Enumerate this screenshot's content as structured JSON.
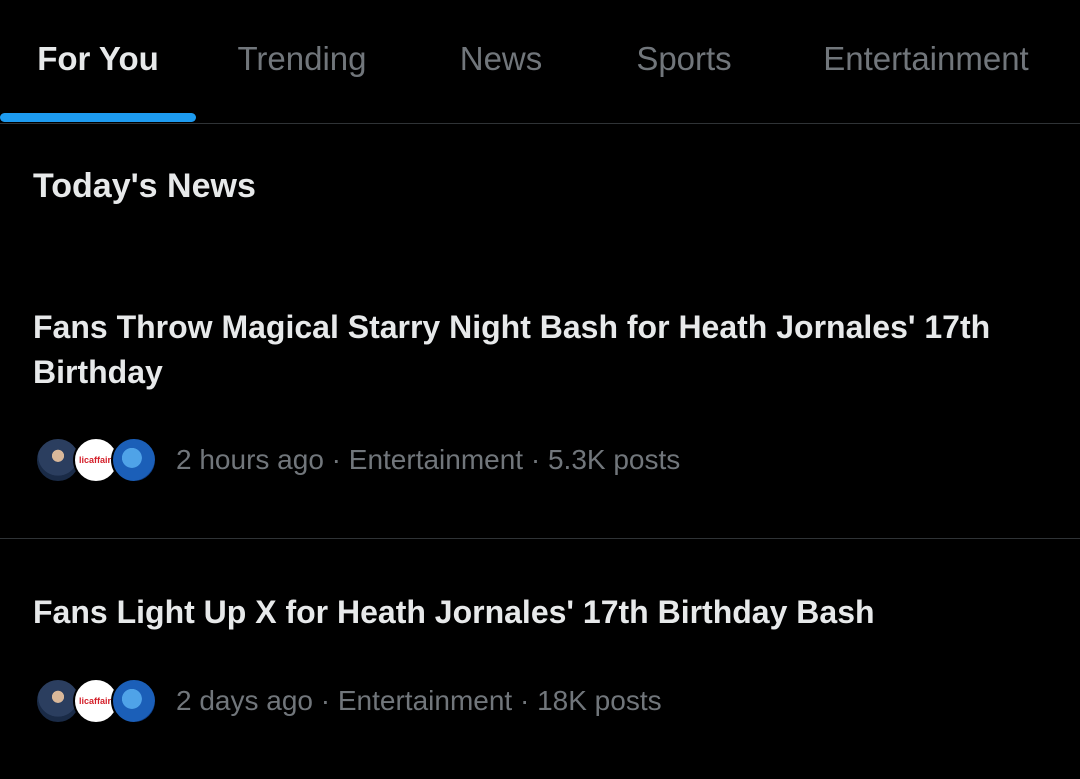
{
  "tabs": [
    {
      "label": "For You",
      "active": true
    },
    {
      "label": "Trending",
      "active": false
    },
    {
      "label": "News",
      "active": false
    },
    {
      "label": "Sports",
      "active": false
    },
    {
      "label": "Entertainment",
      "active": false
    }
  ],
  "accent_color": "#1d9bf0",
  "section_title": "Today's News",
  "stories": [
    {
      "title": "Fans Throw Magical Starry Night Bash for Heath Jornales' 17th Birthday",
      "meta": "2 hours ago · Entertainment · 5.3K posts",
      "avatar_logo_text": "licaffairs"
    },
    {
      "title": "Fans Light Up X for Heath Jornales' 17th Birthday Bash",
      "meta": "2 days ago · Entertainment · 18K posts",
      "avatar_logo_text": "licaffairs"
    }
  ]
}
